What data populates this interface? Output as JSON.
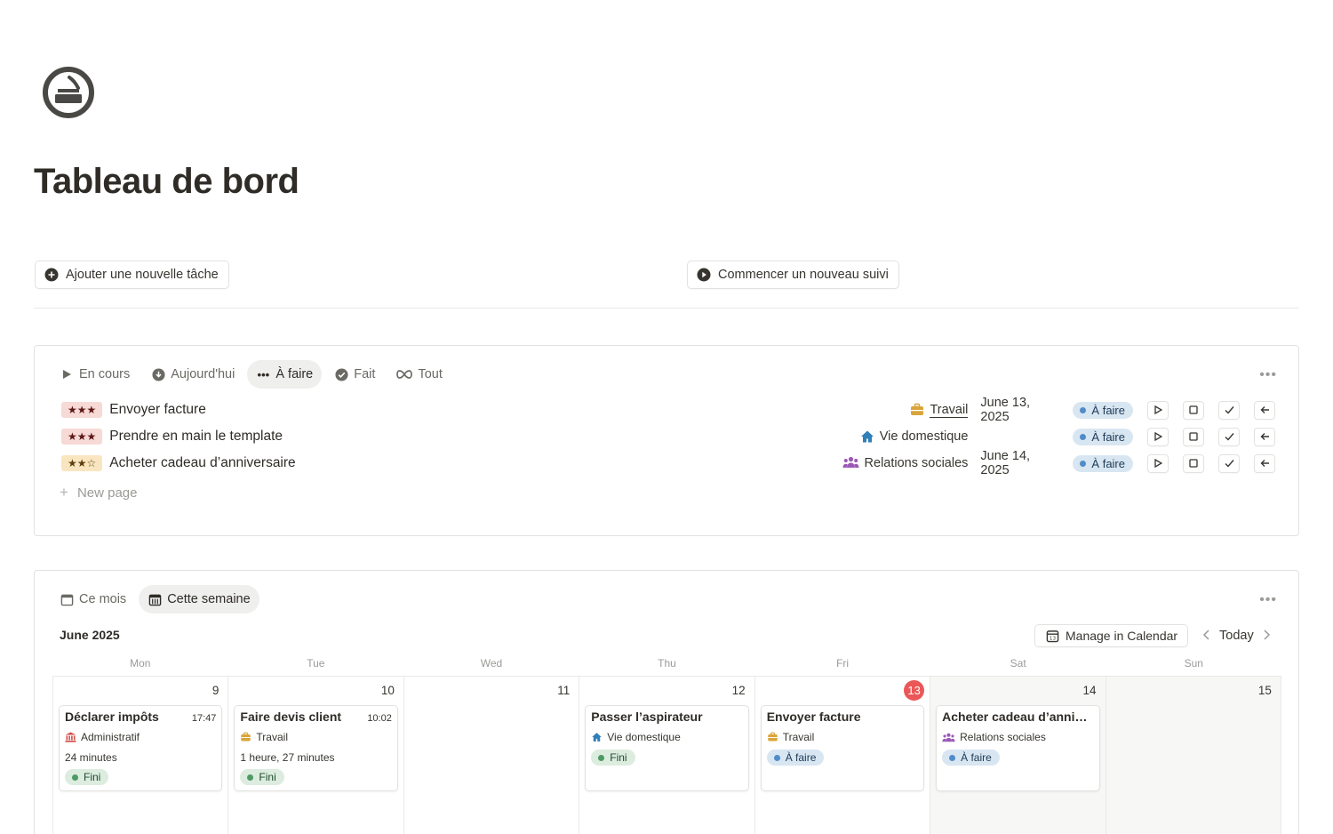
{
  "page": {
    "title": "Tableau de bord",
    "icon": "no-smoking-icon"
  },
  "actions": {
    "add_task": "Ajouter une nouvelle tâche",
    "start_tracking": "Commencer un nouveau suivi"
  },
  "tasks_view": {
    "tabs": [
      {
        "label": "En cours",
        "icon": "play-icon"
      },
      {
        "label": "Aujourd'hui",
        "icon": "arrow-down-circle-icon"
      },
      {
        "label": "À faire",
        "icon": "dots-icon",
        "active": true
      },
      {
        "label": "Fait",
        "icon": "check-circle-icon"
      },
      {
        "label": "Tout",
        "icon": "infinity-icon"
      }
    ],
    "more": "•••",
    "rows": [
      {
        "stars": "★★★",
        "name": "Envoyer facture",
        "category": "Travail",
        "date": "June 13, 2025",
        "status": "À faire"
      },
      {
        "stars": "★★★",
        "name": "Prendre en main le template",
        "category": "Vie domestique",
        "date": "",
        "status": "À faire"
      },
      {
        "stars": "★★☆",
        "name": "Acheter cadeau d’anniversaire",
        "category": "Relations sociales",
        "date": "June 14, 2025",
        "status": "À faire"
      }
    ],
    "new_page": "New page"
  },
  "calendar_view": {
    "tabs": [
      {
        "label": "Ce mois",
        "icon": "calendar-icon"
      },
      {
        "label": "Cette semaine",
        "icon": "calendar-week-icon",
        "active": true
      }
    ],
    "more": "•••",
    "month": "June 2025",
    "manage_label": "Manage in Calendar",
    "today_label": "Today",
    "day_names": [
      "Mon",
      "Tue",
      "Wed",
      "Thu",
      "Fri",
      "Sat",
      "Sun"
    ],
    "days": [
      {
        "num": "9",
        "card": {
          "title": "Déclarer impôts",
          "time": "17:47",
          "category": "Administratif",
          "duration": "24 minutes",
          "status": "Fini"
        }
      },
      {
        "num": "10",
        "card": {
          "title": "Faire devis client",
          "time": "10:02",
          "category": "Travail",
          "duration": "1 heure, 27 minutes",
          "status": "Fini"
        }
      },
      {
        "num": "11"
      },
      {
        "num": "12",
        "card": {
          "title": "Passer l’aspirateur",
          "category": "Vie domestique",
          "status": "Fini"
        }
      },
      {
        "num": "13",
        "today": true,
        "card": {
          "title": "Envoyer facture",
          "category": "Travail",
          "status": "À faire"
        }
      },
      {
        "num": "14",
        "card": {
          "title": "Acheter cadeau d’annive...",
          "category": "Relations sociales",
          "status": "À faire"
        }
      },
      {
        "num": "15"
      }
    ]
  },
  "colors": {
    "today_red": "#eb5757",
    "todo_blue": "#4f8cc9",
    "done_green": "#4d9a63",
    "travail": "#d9a53a",
    "vie_domestique": "#2f7fb8",
    "relations": "#9b59b6",
    "administratif": "#d44c47"
  }
}
